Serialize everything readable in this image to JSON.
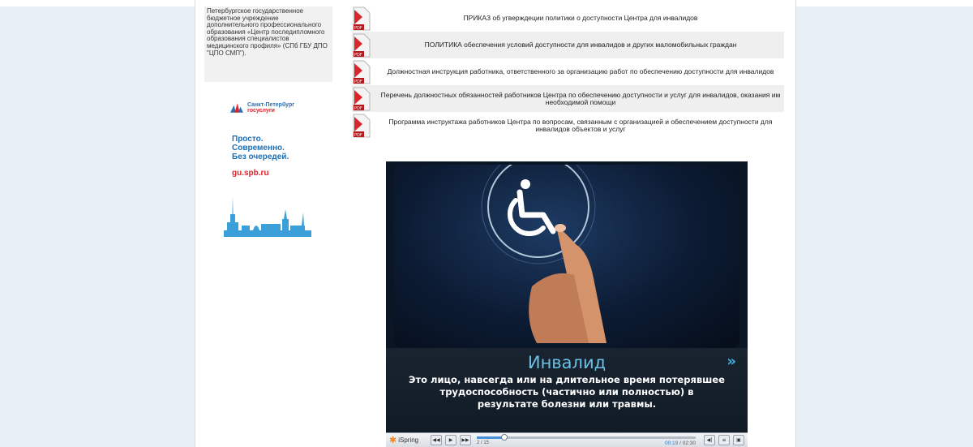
{
  "org_text": "Петербургское государственное бюджетное учреждение дополнительного профессионального образования «Центр последипломного образования специалистов медицинского профиля» (СПб ГБУ ДПО \"ЦПО СМП\").",
  "banner": {
    "logo_line1": "Санкт-Петербург",
    "logo_line2": "госуслуги",
    "slogan": [
      "Просто.",
      "Современно.",
      "Без очередей."
    ],
    "url": "gu.spb.ru",
    "brand_color": "#2c6fb5",
    "accent_color": "#e2222b"
  },
  "documents": [
    {
      "icon": "pdf-icon",
      "label": "ПРИКАЗ об угверждеции политики о доступности Центра для инвалидов"
    },
    {
      "icon": "pdf-icon",
      "label": "ПОЛИТИКА обеспечения условий доступности для инвалидов и других маломобильных граждан"
    },
    {
      "icon": "pdf-icon",
      "label": "Должностная инструкция работника, ответственного за организацию работ по обеспечению доступности для инвалидов"
    },
    {
      "icon": "pdf-icon",
      "label": "Перечень должностных обязанностей работников Центра по обеспечению доступности и услуг для инвалидов, оказания им необходимой помощи"
    },
    {
      "icon": "pdf-icon",
      "label": "Программа инструктажа работников Центра по вопросам, связанным с организацией и обеспечением доступности для инвалидов объектов и услуг"
    }
  ],
  "player": {
    "title": "Инвалид",
    "text": "Это лицо, навсегда или на длительное время потерявшее трудоспособность (частично или полностью) в результате болезни или травмы.",
    "next_icon": "»",
    "brand": "iSpring",
    "slide_counter": "2 / 15",
    "current_time": "00:19",
    "total_time": "02:30",
    "progress": 0.127,
    "accent_color": "#6ac1e4"
  }
}
